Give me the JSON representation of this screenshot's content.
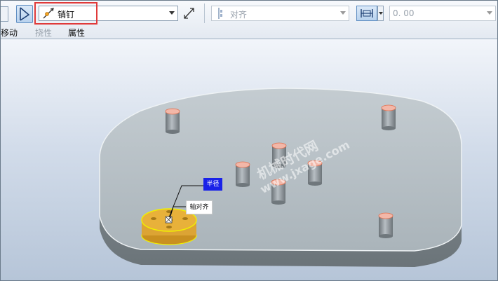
{
  "toolbar": {
    "component_type": {
      "value": "销钉"
    },
    "constraint": {
      "value": "对齐"
    },
    "offset": {
      "value": "0. 00"
    }
  },
  "tabs": {
    "move": "移动",
    "flexibility": "挠性",
    "properties": "属性"
  },
  "viewport": {
    "labels": {
      "radius": "半径",
      "axis_align": "轴对齐"
    },
    "watermark": {
      "cn": "机械时代网",
      "url": "www.jxage.com"
    }
  },
  "colors": {
    "highlight_box": "#e03a3a",
    "radius_label_bg": "#1a22e8",
    "selected_part": "#e8b13a",
    "pin_top": "#f2b7a8",
    "plate": "#b8c4ca"
  },
  "icons": {
    "selection_tool": "selection-pointer-icon",
    "component_type": "pin-connection-icon",
    "flip": "flip-direction-icon",
    "constraint": "align-constraint-icon",
    "orientation": "orientation-icon"
  }
}
